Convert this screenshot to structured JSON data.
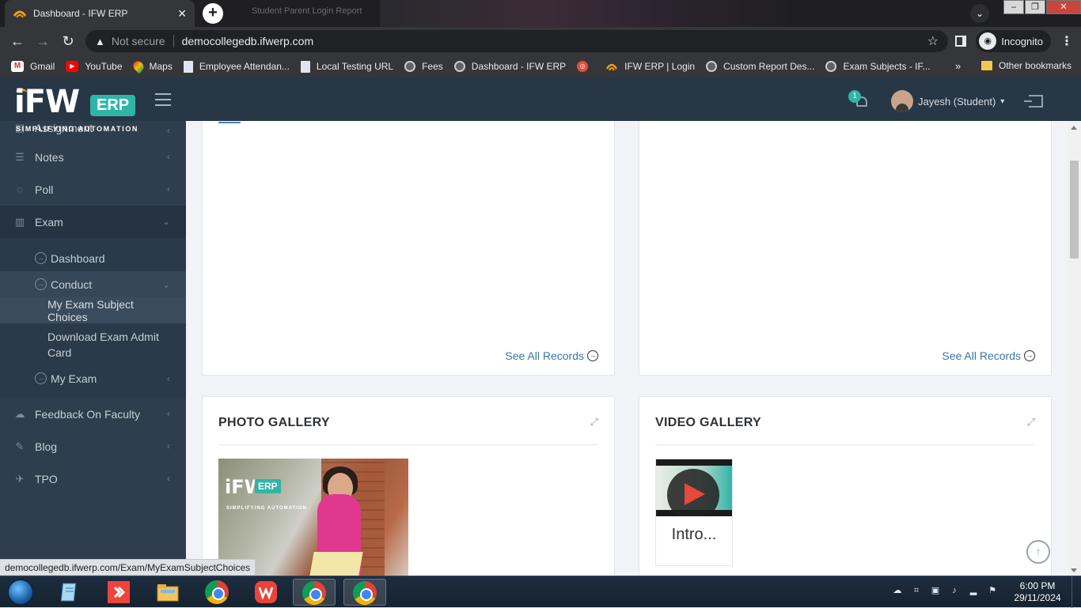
{
  "browser": {
    "active_tab": {
      "title": "Dashboard - IFW ERP"
    },
    "ghost_tab": "Student Parent Login Report",
    "address": {
      "security": "Not secure",
      "url": "democollegedb.ifwerp.com"
    },
    "profile": "Incognito",
    "bookmarks": [
      {
        "label": "Gmail",
        "icon": "gmail-icon"
      },
      {
        "label": "YouTube",
        "icon": "youtube-icon"
      },
      {
        "label": "Maps",
        "icon": "maps-icon"
      },
      {
        "label": "Employee Attendan...",
        "icon": "page-icon"
      },
      {
        "label": "Local Testing URL",
        "icon": "page-icon"
      },
      {
        "label": "Fees",
        "icon": "globe-icon"
      },
      {
        "label": "Dashboard - IFW ERP",
        "icon": "globe-icon"
      },
      {
        "label": "",
        "icon": "target-icon"
      },
      {
        "label": "IFW ERP | Login",
        "icon": "ifw-icon"
      },
      {
        "label": "Custom Report Des...",
        "icon": "globe-icon"
      },
      {
        "label": "Exam Subjects - IF...",
        "icon": "globe-icon"
      }
    ],
    "bookmarks_more": "»",
    "other_bookmarks": "Other bookmarks",
    "status_url": "democollegedb.ifwerp.com/Exam/MyExamSubjectChoices"
  },
  "header": {
    "logo_text": "iFW",
    "logo_badge": "ERP",
    "logo_tagline": "SIMPLIFYING AUTOMATION",
    "notification_count": "1",
    "user_name": "Jayesh (Student)"
  },
  "sidebar": {
    "items": [
      {
        "label": "Assignment",
        "icon": "assignment-icon"
      },
      {
        "label": "Notes",
        "icon": "notes-icon"
      },
      {
        "label": "Poll",
        "icon": "poll-icon"
      },
      {
        "label": "Exam",
        "icon": "chart-icon"
      }
    ],
    "exam_sub": {
      "dashboard": "Dashboard",
      "conduct": "Conduct",
      "my_exam_subject_choices": "My Exam Subject Choices",
      "download_admit_card": "Download Exam Admit Card",
      "my_exam": "My Exam"
    },
    "items_after": [
      {
        "label": "Feedback On Faculty",
        "icon": "comments-icon"
      },
      {
        "label": "Blog",
        "icon": "pencil-icon"
      },
      {
        "label": "TPO",
        "icon": "plane-icon"
      }
    ]
  },
  "main": {
    "see_all_left": "See All Records",
    "see_all_right": "See All Records",
    "photo_gallery": {
      "title": "PHOTO GALLERY",
      "logo_text": "iFW",
      "logo_badge": "ERP",
      "logo_tagline": "SIMPLIFYING AUTOMATION"
    },
    "video_gallery": {
      "title": "VIDEO GALLERY",
      "video_title": "Intro..."
    }
  },
  "taskbar": {
    "time": "6:00 PM",
    "date": "29/11/2024"
  }
}
